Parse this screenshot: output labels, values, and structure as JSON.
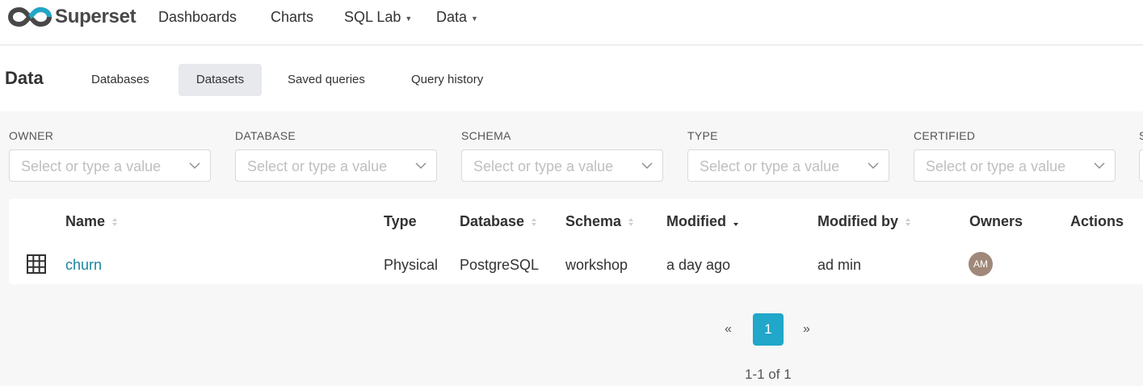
{
  "nav": {
    "brand": "Superset",
    "items": [
      {
        "label": "Dashboards"
      },
      {
        "label": "Charts"
      },
      {
        "label": "SQL Lab"
      },
      {
        "label": "Data"
      }
    ]
  },
  "subheader": {
    "title": "Data",
    "tabs": [
      {
        "label": "Databases"
      },
      {
        "label": "Datasets",
        "active": true
      },
      {
        "label": "Saved queries"
      },
      {
        "label": "Query history"
      }
    ]
  },
  "filters": [
    {
      "label": "OWNER",
      "placeholder": "Select or type a value"
    },
    {
      "label": "DATABASE",
      "placeholder": "Select or type a value"
    },
    {
      "label": "SCHEMA",
      "placeholder": "Select or type a value"
    },
    {
      "label": "TYPE",
      "placeholder": "Select or type a value"
    },
    {
      "label": "CERTIFIED",
      "placeholder": "Select or type a value"
    }
  ],
  "partial_filter_label": "S",
  "table": {
    "columns": [
      "Name",
      "Type",
      "Database",
      "Schema",
      "Modified",
      "Modified by",
      "Owners",
      "Actions"
    ],
    "rows": [
      {
        "icon": "table-grid-icon",
        "name": "churn",
        "type": "Physical",
        "database": "PostgreSQL",
        "schema": "workshop",
        "modified": "a day ago",
        "modified_by": "ad min",
        "owner_initials": "AM"
      }
    ]
  },
  "pagination": {
    "prev": "«",
    "current": "1",
    "next": "»",
    "summary": "1-1 of 1"
  },
  "colors": {
    "accent": "#20a7c9",
    "link": "#1a85a0",
    "avatar": "#a0897a"
  }
}
